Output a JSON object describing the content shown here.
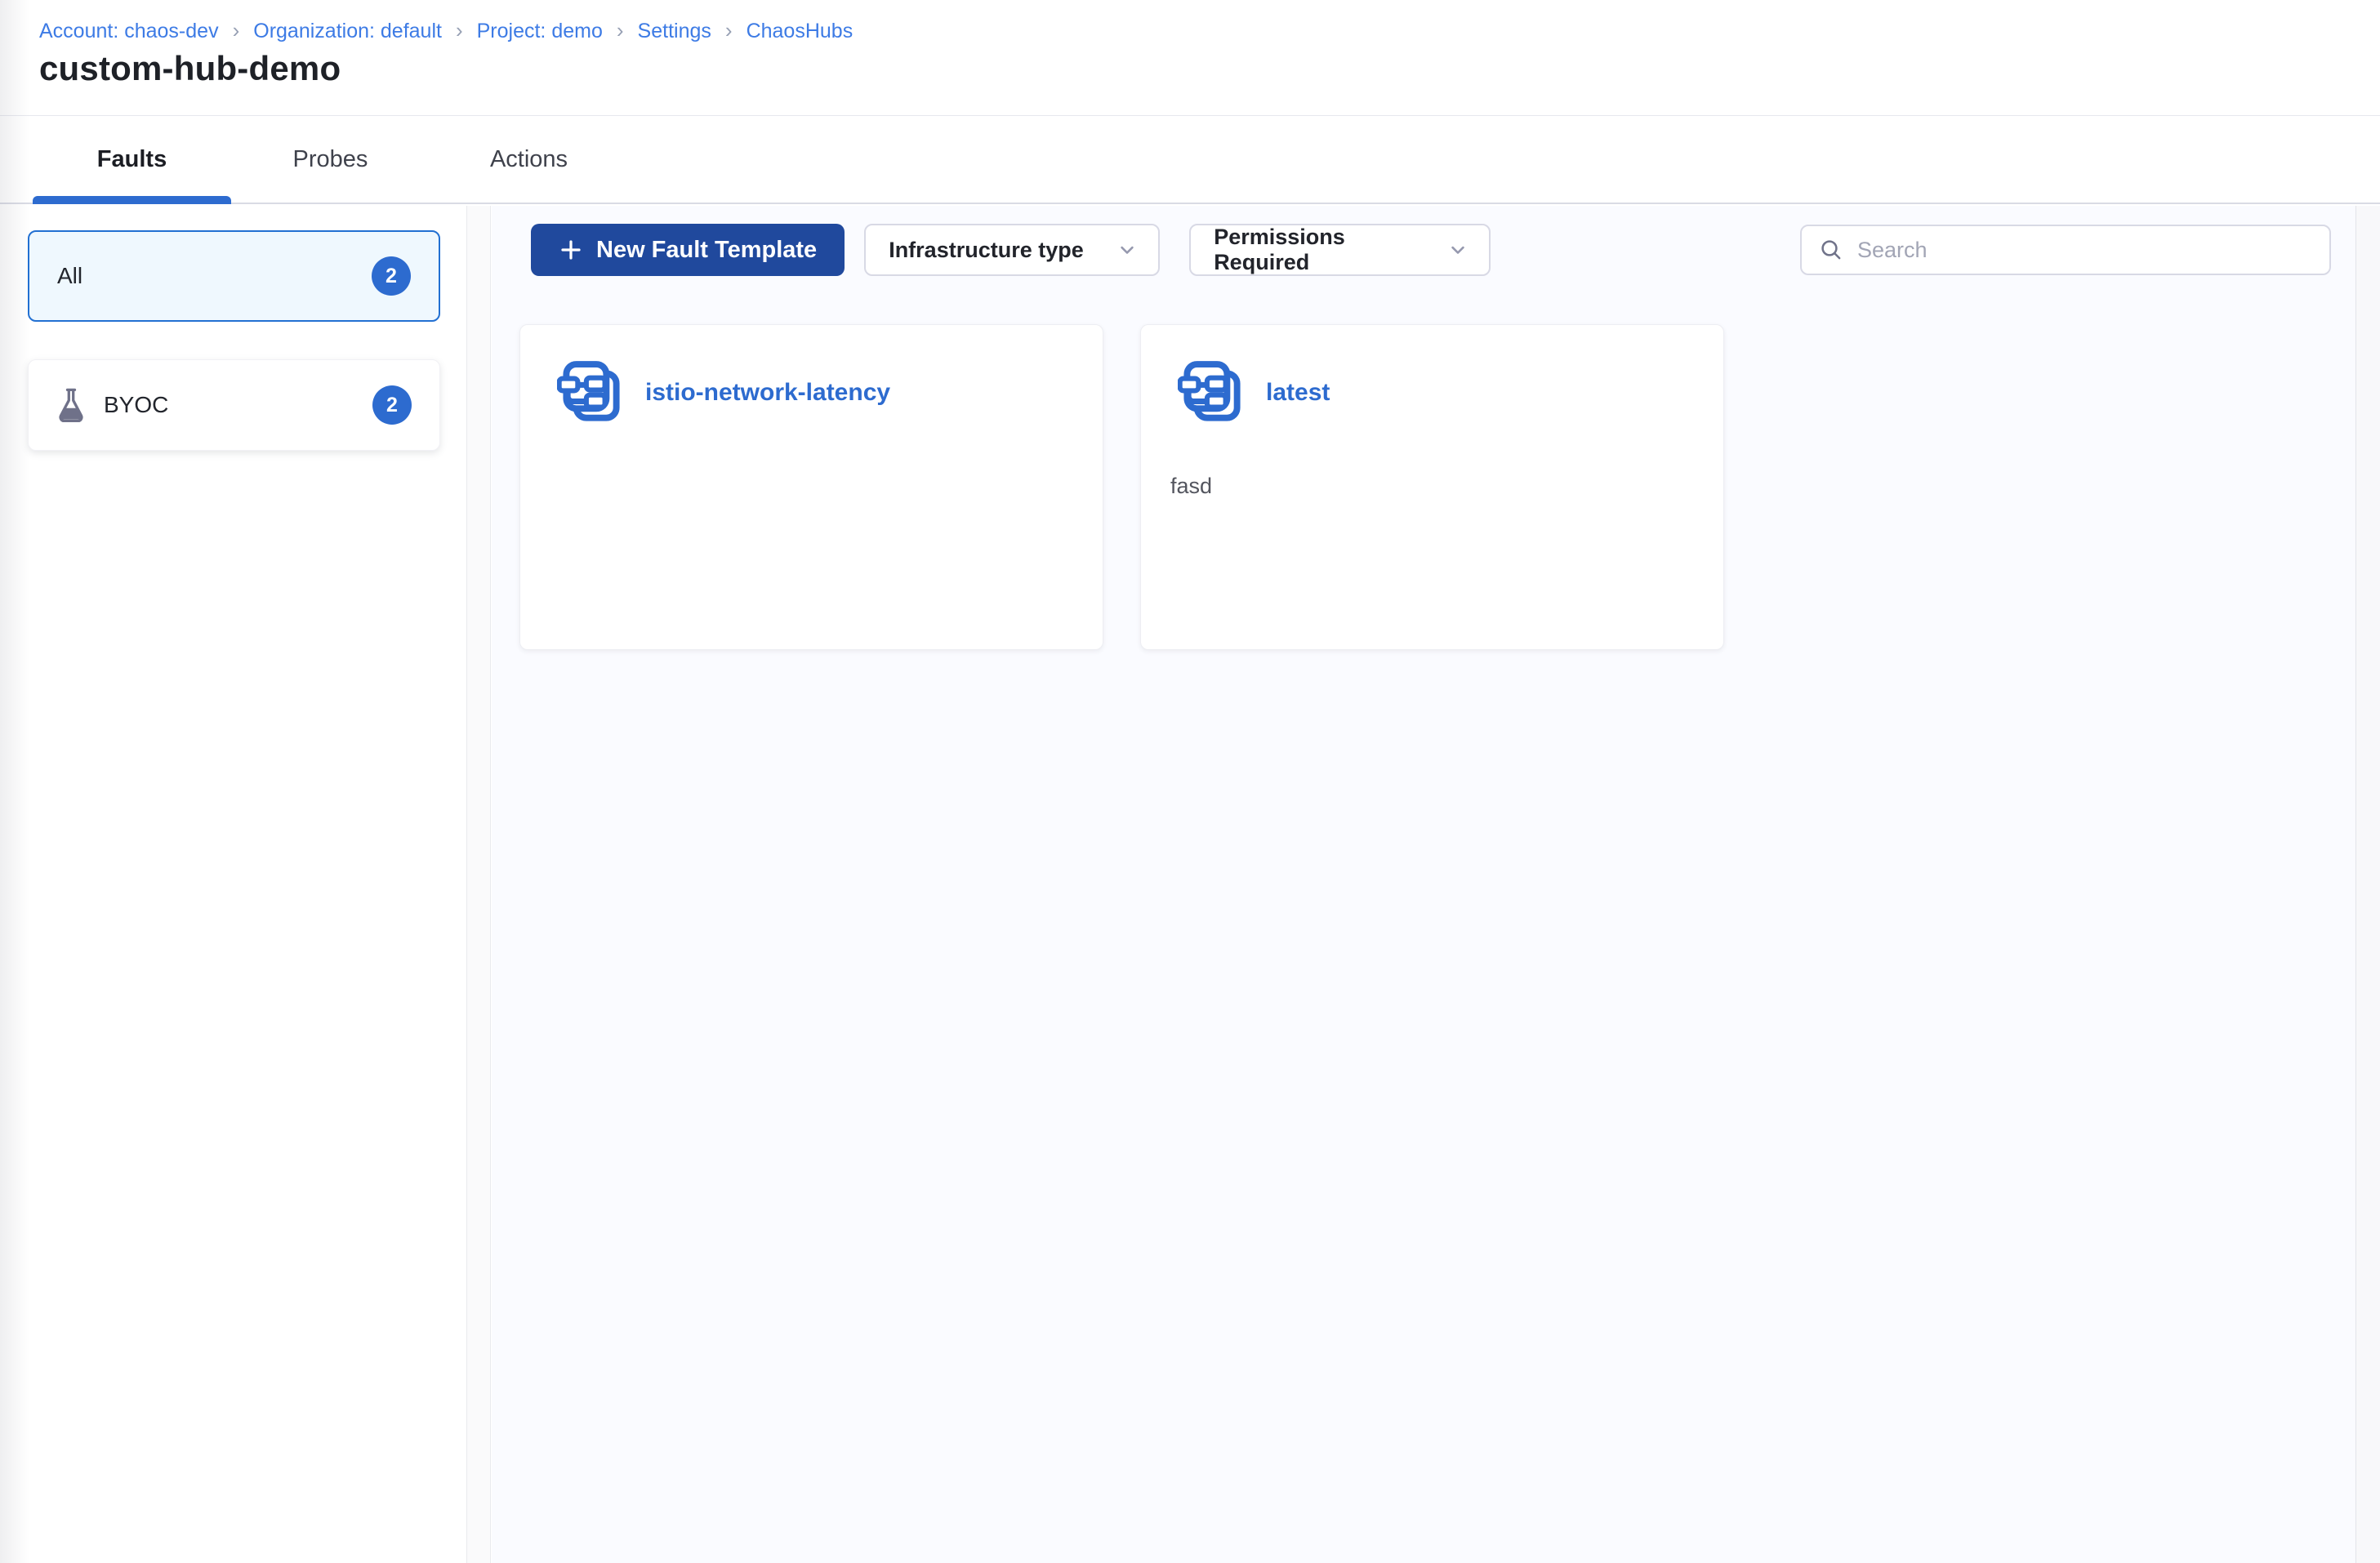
{
  "breadcrumb": {
    "separator": "›",
    "items": [
      "Account: chaos-dev",
      "Organization: default",
      "Project: demo",
      "Settings",
      "ChaosHubs"
    ]
  },
  "page": {
    "title": "custom-hub-demo"
  },
  "tabs": [
    {
      "label": "Faults",
      "active": true
    },
    {
      "label": "Probes",
      "active": false
    },
    {
      "label": "Actions",
      "active": false
    }
  ],
  "sidebar": {
    "items": [
      {
        "label": "All",
        "count": "2",
        "selected": true
      },
      {
        "label": "BYOC",
        "count": "2",
        "icon": "flask-icon",
        "selected": false
      }
    ]
  },
  "toolbar": {
    "new_fault_template_button": "New Fault Template",
    "filters": [
      {
        "label": "Infrastructure type"
      },
      {
        "label": "Permissions Required"
      }
    ],
    "search": {
      "placeholder": "Search"
    }
  },
  "cards": [
    {
      "title": "istio-network-latency",
      "description": ""
    },
    {
      "title": "latest",
      "description": "fasd"
    }
  ],
  "colors": {
    "accent_blue": "#2D6BCF",
    "button_blue": "#20499D",
    "link_blue": "#3D7BE5",
    "selected_card_bg": "#EFF8FE",
    "selected_card_border": "#2270D2",
    "badge_bg": "#2D6BCF",
    "main_bg": "#FAFBFF"
  }
}
